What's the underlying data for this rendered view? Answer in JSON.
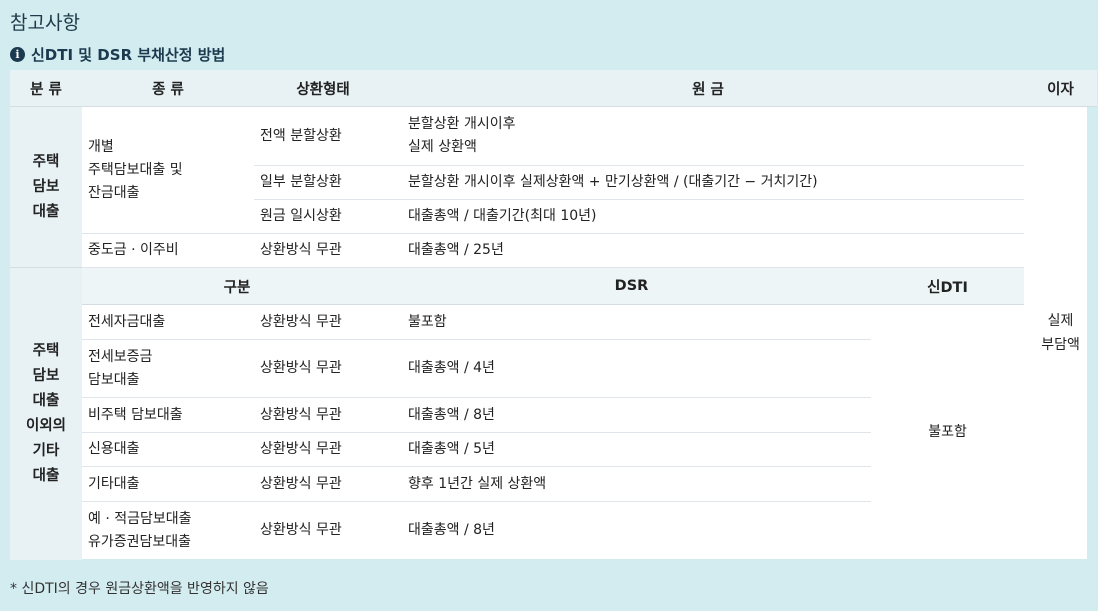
{
  "page_title": "참고사항",
  "section": {
    "icon": "info-icon",
    "title": "신DTI 및 DSR 부채산정 방법"
  },
  "headers": {
    "category": "분 류",
    "type": "종 류",
    "repayment": "상환형태",
    "principal": "원 금",
    "interest": "이자"
  },
  "mortgage": {
    "category_lines": [
      "주택",
      "담보",
      "대출"
    ],
    "individual_lines": [
      "개별",
      "주택담보대출 및",
      "잔금대출"
    ],
    "rows": [
      {
        "method": "전액 분할상환",
        "principal_lines": [
          "분할상환 개시이후",
          "실제 상환액"
        ]
      },
      {
        "method": "일부 분할상환",
        "principal": "분할상환 개시이후 실제상환액 + 만기상환액 / (대출기간 − 거치기간)"
      },
      {
        "method": "원금 일시상환",
        "principal": "대출총액 / 대출기간(최대 10년)"
      }
    ],
    "interim": {
      "name": "중도금 · 이주비",
      "method": "상환방식 무관",
      "principal": "대출총액 / 25년"
    }
  },
  "other": {
    "category_lines": [
      "주택",
      "담보",
      "대출",
      "이외의",
      "기타",
      "대출"
    ],
    "subheaders": {
      "division": "구분",
      "dsr": "DSR",
      "new_dti": "신DTI"
    },
    "new_dti_value": "불포함",
    "rows": [
      {
        "name_lines": [
          "전세자금대출"
        ],
        "method": "상환방식 무관",
        "dsr": "불포함"
      },
      {
        "name_lines": [
          "전세보증금",
          "담보대출"
        ],
        "method": "상환방식 무관",
        "dsr": "대출총액 / 4년"
      },
      {
        "name_lines": [
          "비주택 담보대출"
        ],
        "method": "상환방식 무관",
        "dsr": "대출총액 / 8년"
      },
      {
        "name_lines": [
          "신용대출"
        ],
        "method": "상환방식 무관",
        "dsr": "대출총액 / 5년"
      },
      {
        "name_lines": [
          "기타대출"
        ],
        "method": "상환방식 무관",
        "dsr": "향후 1년간 실제 상환액"
      },
      {
        "name_lines": [
          "예 · 적금담보대출",
          "유가증권담보대출"
        ],
        "method": "상환방식 무관",
        "dsr": "대출총액 / 8년"
      }
    ]
  },
  "interest_lines": [
    "실제",
    "부담액"
  ],
  "footnote": "* 신DTI의 경우 원금상환액을 반영하지 않음"
}
